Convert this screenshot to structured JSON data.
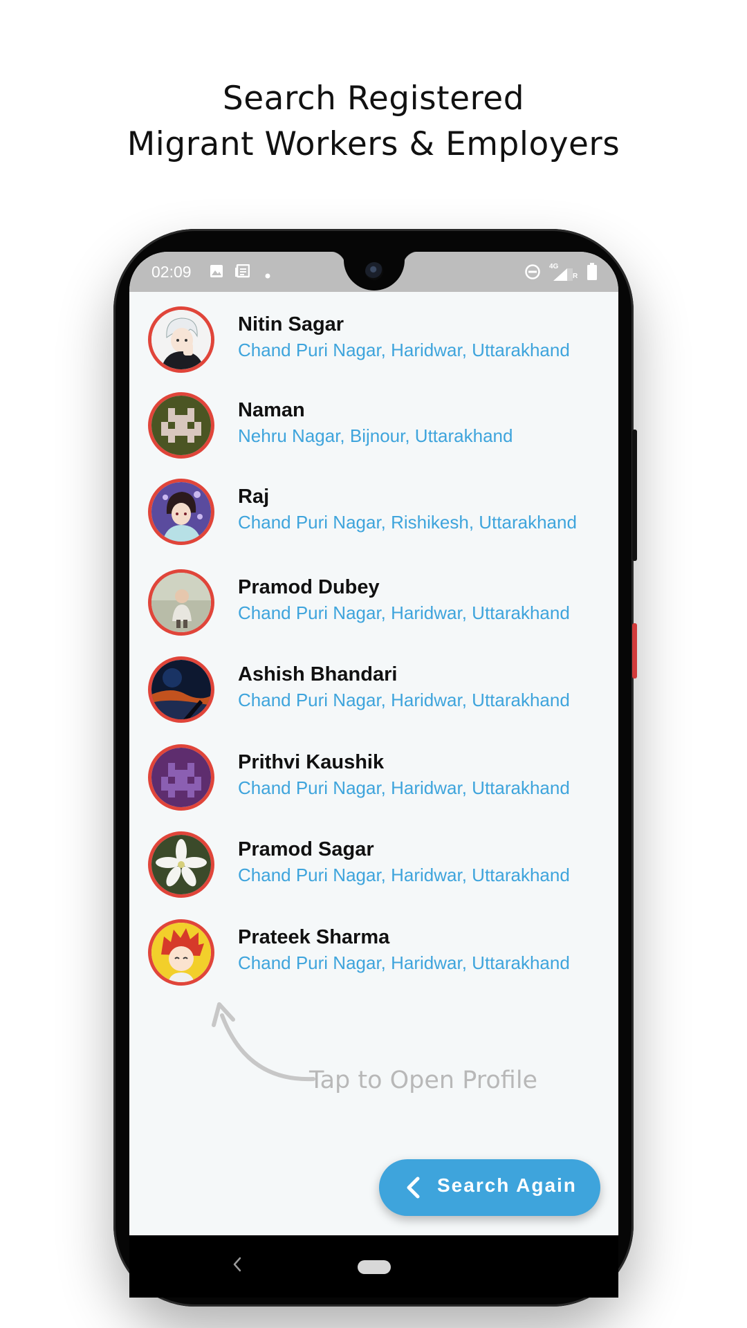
{
  "headline": {
    "line1": "Search Registered",
    "line2": "Migrant Workers & Employers"
  },
  "status_bar": {
    "time": "02:09",
    "network": "4G",
    "sim": "R"
  },
  "contacts": [
    {
      "name": "Nitin Sagar",
      "address": "Chand Puri Nagar, Haridwar, Uttarakhand",
      "avatar": "anime-boy-avatar"
    },
    {
      "name": "Naman",
      "address": "Nehru Nagar, Bijnour, Uttarakhand",
      "avatar": "pixel-invader-olive-avatar"
    },
    {
      "name": "Raj",
      "address": "Chand Puri Nagar, Rishikesh, Uttarakhand",
      "avatar": "anime-swordsman-avatar"
    },
    {
      "name": "Pramod Dubey",
      "address": "Chand Puri Nagar, Haridwar, Uttarakhand",
      "avatar": "child-photo-avatar"
    },
    {
      "name": "Ashish Bhandari",
      "address": "Chand Puri Nagar, Haridwar, Uttarakhand",
      "avatar": "night-scene-avatar"
    },
    {
      "name": "Prithvi Kaushik",
      "address": "Chand Puri Nagar, Haridwar, Uttarakhand",
      "avatar": "pixel-invader-purple-avatar"
    },
    {
      "name": "Pramod Sagar",
      "address": "Chand Puri Nagar, Haridwar, Uttarakhand",
      "avatar": "white-flower-avatar"
    },
    {
      "name": "Prateek Sharma",
      "address": "Chand Puri Nagar, Haridwar, Uttarakhand",
      "avatar": "red-hair-anime-avatar"
    }
  ],
  "hint": "Tap to Open Profile",
  "fab": {
    "label": "Search Again",
    "icon": "chevron-left-icon"
  },
  "colors": {
    "accent": "#3ea4dc",
    "avatar_ring": "#e0453a",
    "screen_bg": "#f5f8f9"
  }
}
